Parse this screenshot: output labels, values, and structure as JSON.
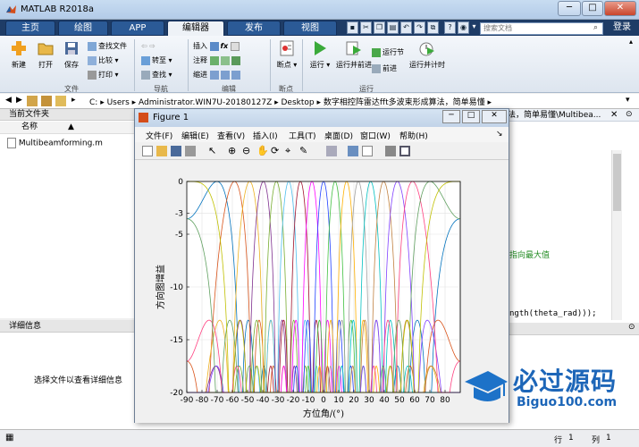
{
  "app": {
    "title": "MATLAB R2018a"
  },
  "tabs": [
    {
      "label": "主页"
    },
    {
      "label": "绘图"
    },
    {
      "label": "APP"
    },
    {
      "label": "编辑器"
    },
    {
      "label": "发布"
    },
    {
      "label": "视图"
    }
  ],
  "search": {
    "placeholder": "搜索文档"
  },
  "login": "登录",
  "toolstrip": {
    "file": {
      "label": "文件",
      "new": "新建",
      "open": "打开",
      "save": "保存",
      "find_files": "查找文件",
      "compare": "比较",
      "print": "打印"
    },
    "nav": {
      "label": "导航",
      "goto": "转至",
      "find": "查找"
    },
    "edit": {
      "label": "编辑",
      "insert": "插入",
      "comment": "注释",
      "indent": "缩进",
      "fx": "fx"
    },
    "breakpoint": {
      "label": "断点",
      "breakpoints": "断点"
    },
    "run": {
      "label": "运行",
      "run": "运行",
      "run_advance": "运行并前进",
      "run_section": "运行节",
      "advance": "前进",
      "run_time": "运行并计时"
    }
  },
  "address": {
    "segments": [
      "C:",
      "Users",
      "Administrator.WIN7U-20180127Z",
      "Desktop",
      "数字相控阵雷达fft多波束形成算法，简单易懂"
    ]
  },
  "current_folder": {
    "title": "当前文件夹",
    "col_name": "名称",
    "files": [
      "Multibeamforming.m"
    ]
  },
  "details": {
    "title": "详细信息",
    "hint": "选择文件以查看详细信息"
  },
  "editor": {
    "tab_title": "法，简单易懂\\Multibea...",
    "lines": [
      "指向最大值",
      "ngth(theta_rad)));"
    ]
  },
  "status": {
    "row_label": "行",
    "row": "1",
    "col_label": "列",
    "col": "1"
  },
  "figure": {
    "title": "Figure 1",
    "menus": [
      "文件(F)",
      "编辑(E)",
      "查看(V)",
      "插入(I)",
      "工具(T)",
      "桌面(D)",
      "窗口(W)",
      "帮助(H)"
    ]
  },
  "watermark": {
    "text": "必过源码",
    "url": "Biguo100.com"
  },
  "colors": {
    "titlebar": "#c8dcf1",
    "tabbar": "#1e3c66",
    "editor_tab": "#eef2f7",
    "comment_green": "#228b22"
  },
  "chart_data": {
    "type": "line",
    "xlabel": "方位角/(°)",
    "ylabel": "方向图增益",
    "xlim": [
      -90,
      90
    ],
    "ylim": [
      -20,
      0
    ],
    "xticks": [
      -90,
      -80,
      -70,
      -60,
      -50,
      -40,
      -30,
      -20,
      -10,
      0,
      10,
      20,
      30,
      40,
      50,
      60,
      70,
      80
    ],
    "yticks": [
      0,
      -3,
      -5,
      -10,
      -15,
      -20
    ],
    "grid": true,
    "num_elements": 16,
    "beam_angles": [
      -70.1,
      -58.6,
      -48.6,
      -39.6,
      -31.0,
      -22.9,
      -15.2,
      -7.6,
      0,
      7.6,
      15.2,
      22.9,
      31.0,
      39.6,
      48.6,
      58.6,
      70.1,
      90
    ],
    "series_colors": [
      "#0072bd",
      "#d95319",
      "#edb120",
      "#7e2f8e",
      "#77ac30",
      "#4dbeee",
      "#a2142f",
      "#ff00ff",
      "#2040ff",
      "#40c040",
      "#ffb000",
      "#a0a0a0",
      "#00c0c0",
      "#c08040",
      "#8040ff",
      "#ff4080",
      "#60a060",
      "#c0c000"
    ]
  }
}
